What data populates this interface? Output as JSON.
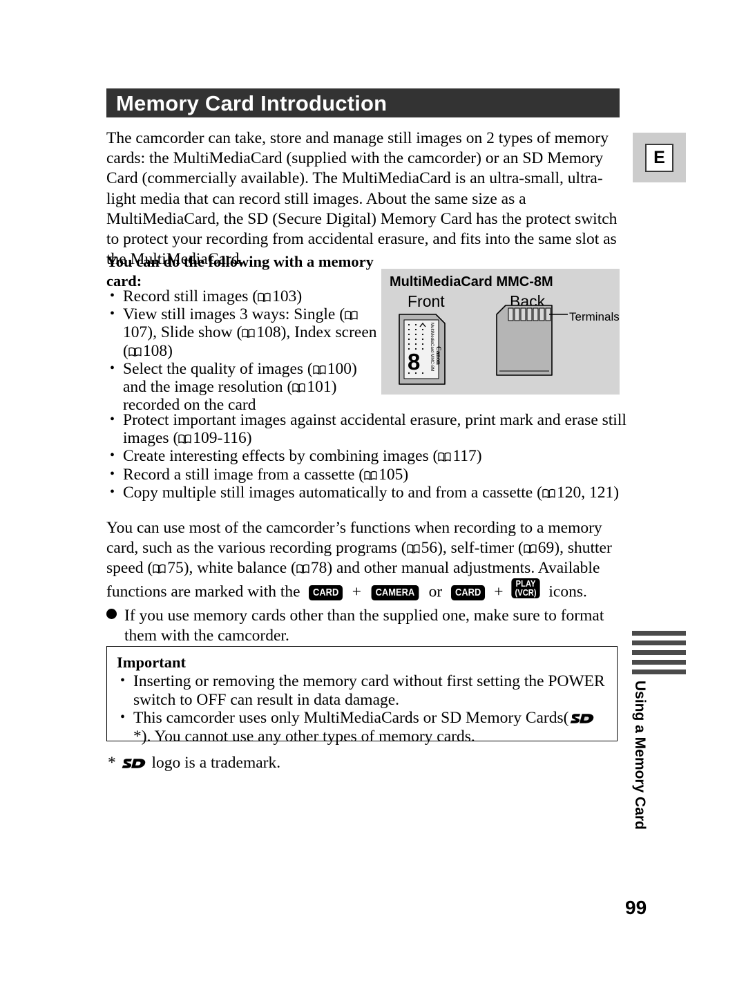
{
  "header": {
    "title": "Memory Card Introduction",
    "language_tab": "E"
  },
  "intro_paragraph": "The camcorder can take, store and manage still images on 2 types of memory cards: the MultiMediaCard (supplied with the camcorder) or an SD Memory Card (commercially available). The MultiMediaCard is an ultra-small, ultra-light media that can record still images. About the same size as a MultiMediaCard, the SD (Secure Digital) Memory Card has the protect switch to protect your recording from accidental erasure, and fits into the same slot as the MultiMediaCard.",
  "lead_in": "You can do the following with a memory card:",
  "bullets_left": [
    "Record still images ( 103)",
    "View still images 3 ways: Single ( 107), Slide show ( 108), Index screen ( 108)",
    "Select the quality of images ( 100) and the image resolution ( 101) recorded on the card"
  ],
  "bullets_wide": [
    "Protect important images against accidental erasure, print mark and erase still images ( 109-116)",
    "Create interesting effects by combining images ( 117)",
    "Record a still image from a cassette ( 105)",
    "Copy multiple still images automatically to and from a cassette ( 120, 121)"
  ],
  "bullet_refs": {
    "b1": [
      "103"
    ],
    "b2": [
      "107",
      "108",
      "108"
    ],
    "b3": [
      "100",
      "101"
    ],
    "w1": [
      "109-116"
    ],
    "w2": [
      "117"
    ],
    "w3": [
      "105"
    ],
    "w4": [
      "120, 121"
    ]
  },
  "functions_paragraph": {
    "part1": "You can use most of the camcorder’s functions when recording to a memory card, such as the various recording programs (",
    "ref1": "56",
    "part2": "), self-timer (",
    "ref2": "69",
    "part3": "), shutter speed (",
    "ref3": "75",
    "part4": "), white balance (",
    "ref4": "78",
    "part5": ") and other manual adjustments. Available functions are marked with the",
    "badge_card_1": "CARD",
    "plus_1": "+",
    "badge_camera": "CAMERA",
    "or_text": "or",
    "badge_card_2": "CARD",
    "plus_2": "+",
    "badge_play_line1": "PLAY",
    "badge_play_line2": "(VCR)",
    "part6": "icons."
  },
  "dot_note": "If you use memory cards other than the supplied one, make sure to format them with the camcorder.",
  "important": {
    "title": "Important",
    "items": [
      "Inserting or removing the memory card without first setting the POWER switch to OFF can result in data damage.",
      "This camcorder uses only MultiMediaCards or SD Memory Cards(  *). You cannot use any other types of memory cards."
    ],
    "item2_before": "This camcorder uses only MultiMediaCards or SD Memory Cards(",
    "item2_after": "*).",
    "item2_line2": "You cannot use any other types of memory cards."
  },
  "footnote": {
    "star": "*",
    "text": "logo is a trademark."
  },
  "illustration": {
    "title": "MultiMediaCard MMC-8M",
    "label_front": "Front",
    "label_back": "Back",
    "label_terminals": "Terminals",
    "card_label_brand": "Canon",
    "card_label_model": "MultiMediaCard MMC-8M",
    "card_capacity": "8"
  },
  "side_tab": {
    "vertical_text": "Using a Memory Card",
    "bar_count": 5
  },
  "page_number": "99",
  "colors": {
    "heading_bar": "#333333",
    "illustration_panel": "#d4d4d4",
    "lang_tab_bg": "#cccccc",
    "side_bar": "#4a4a4a",
    "card_body": "#b5b5b5"
  }
}
